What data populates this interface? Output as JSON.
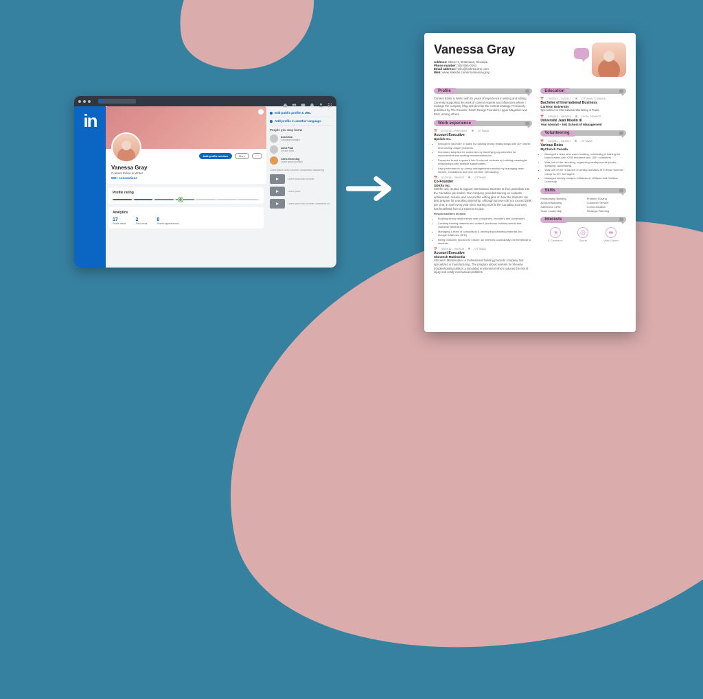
{
  "linkedin": {
    "logo_text": "in",
    "nav_icons": [
      "home-icon",
      "network-icon",
      "jobs-icon",
      "messaging-icon",
      "notifications-icon",
      "apps-icon"
    ],
    "add_section_label": "Add profile section",
    "more_label": "More",
    "name": "Vanessa Gray",
    "headline": "Content Editor & Writer",
    "connections": "500+ connections",
    "profile_rating_title": "Profile rating",
    "analytics_title": "Analytics",
    "metrics": [
      {
        "value": "17",
        "label": "Profile views"
      },
      {
        "value": "2",
        "label": "Post views"
      },
      {
        "value": "8",
        "label": "Search appearances"
      }
    ],
    "side": {
      "edit_link": "Edit public profile & URL",
      "lang_link": "Add profile in another language",
      "people_title": "People you may know",
      "people": [
        {
          "name": "Ava Chen",
          "role": "Campaign Manager"
        },
        {
          "name": "John Paul",
          "role": "Content Lead"
        },
        {
          "name": "Chris Greening",
          "role": "Lorem Ipsum Architect"
        }
      ],
      "promo_text": "Lorem ipsum dolor sit amet, consectetur adipiscing.",
      "videos": [
        "Lorem ipsum dolor sit amet",
        "Lorem ipsum",
        "Lorem ipsum dolor sit amet, consectetur ad"
      ]
    }
  },
  "resume": {
    "name": "Vanessa Gray",
    "contacts": {
      "address_label": "Address:",
      "address": "Street 1, Bratislava, Slovakia",
      "phone_label": "Phone number:",
      "phone": "202-555-0161",
      "email_label": "Email address:",
      "email": "hello@kickresume.com",
      "web_label": "Web:",
      "web": "www.linkedin.com/in/vanessa-gray"
    },
    "sections": {
      "profile": {
        "title": "Profile",
        "text": "Content Editor & Writer with 5+ years of experience in writing and editing. Currently supporting the work of content experts and influencers where I manage the company blog and develop the content strategy. Previously published by The Elevator, SaaS, Design Founders, Hyper Magazine and Boot, among others."
      },
      "work": {
        "title": "Work experience",
        "items": [
          {
            "dates": "07/2018 – PRESENT",
            "location": "OTTAWA",
            "role": "Account Executive",
            "company": "Upclick Inc.",
            "bullets": [
              "Brought in $K250k+ in sales by building strong relationships with 30+ clients and solving unique problems.",
              "Increased adoption for customers by identifying opportunities for improvement and making recommendations.",
              "Expanded brand exposure into 5 external verticals by building meaningful relationships with multiple stakeholders.",
              "Kept performance up during management transition by managing team reports, escalations and new member onboarding."
            ]
          },
          {
            "dates": "01/2016 – 08/2017",
            "location": "OTTAWA",
            "role": "Co-Founder",
            "company": "SOKfix Inc.",
            "text": "SOKfix was created to support international students to then assimilate into the Canadian job market. Our company provided training on LinkedIn optimization, resume and cover letter writing plus on how the students can best prepare for a working internship. Although turnover did not exceed 250k per year, in April every year since starting SOKfix the Canadian Economy has benefitted from our trainees to jobs.",
            "resp_label": "Responsibilities include:",
            "bullets2": [
              "Building strong relationships with companies, recruiters and universities.",
              "Creating training material and content (workshop industry trends and customer feedback).",
              "Managing a team of consultants & developing marketing material (inc. Google AdWords, SEO).",
              "Being customer focused to ensure our services could always be beneficial to students."
            ]
          },
          {
            "dates": "09/2016 – 06/2018",
            "location": "OTTAWA",
            "role": "Account Executive",
            "company": "Shoutech Multimedia",
            "text": "Shoutech Multimedia is a multinational building products company that specializes in manufacturing. The program allows workers to rehearse troubleshooting skills in a simulated environment which reduces the risk of injury and costly mechanical problems."
          }
        ]
      },
      "education": {
        "title": "Education",
        "items": [
          {
            "dates": "09/2013 – 04/2017",
            "location": "OTTAWA, CANADA",
            "degree": "Bachelor of International Business",
            "school": "Carleton University",
            "note": "Specialized in International Marketing & Trade"
          },
          {
            "dates": "01/2015 – 05/2015",
            "location": "LYON, FRANCE",
            "degree": "Université Jean Moulin III",
            "school": "Year Abroad – IAE School of Management"
          }
        ]
      },
      "volunteering": {
        "title": "Volunteering",
        "items": [
          {
            "dates": "01/2011 – 04/2017",
            "location": "OTTAWA",
            "role": "Various Roles",
            "org": "MyChurch Canada",
            "bullets": [
              "Managed a team who was recruiting, scheduling & training the team leaders with +250 members and 100+ volunteers.",
              "Was part of the recruiting, organizing weekly events (audio, speaking, advertising).",
              "Was part of the re-launch of weekly activities at St Rose Summer Camp for 40+ teenagers.",
              "Managed weekly campus initiatives at uOttawa and Carleton University."
            ]
          }
        ]
      },
      "skills": {
        "title": "Skills",
        "items": [
          "Relationship Building",
          "Problem Solving",
          "Account Mapping",
          "Customer Service",
          "Salesforce CRM",
          "Communication",
          "Team Leadership",
          "Strategic Planning"
        ]
      },
      "interests": {
        "title": "Interests",
        "items": [
          "E-Commerce",
          "Soccer",
          "Video Games"
        ]
      }
    }
  }
}
